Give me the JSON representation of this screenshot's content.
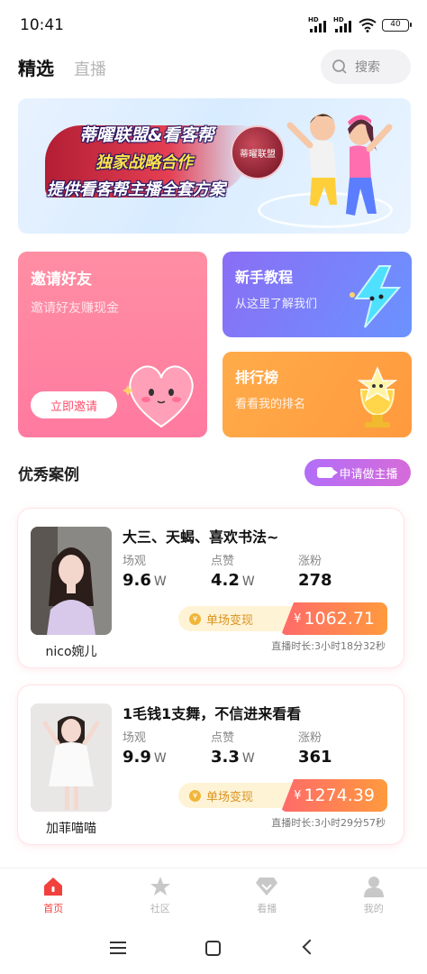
{
  "status_bar": {
    "time": "10:41",
    "signal1_label": "HD",
    "signal2_label": "HD",
    "battery": "40"
  },
  "header": {
    "tabs": [
      {
        "label": "精选",
        "active": true
      },
      {
        "label": "直播",
        "active": false
      }
    ],
    "search": {
      "placeholder": "搜索",
      "icon": "search-icon"
    }
  },
  "banner": {
    "line1": "蒂曜联盟&看客帮",
    "line2": "独家战略合作",
    "line3": "提供看客帮主播全套方案",
    "logo_text": "蒂曜联盟"
  },
  "cards": {
    "invite": {
      "title": "邀请好友",
      "subtitle": "邀请好友赚现金",
      "button": "立即邀请",
      "icon": "heart-icon"
    },
    "tutorial": {
      "title": "新手教程",
      "subtitle": "从这里了解我们",
      "icon": "lightning-icon"
    },
    "rank": {
      "title": "排行榜",
      "subtitle": "看看我的排名",
      "icon": "trophy-icon"
    }
  },
  "section": {
    "title": "优秀案例",
    "apply_button": "申请做主播",
    "apply_icon": "live-camera-icon"
  },
  "labels": {
    "views": "场观",
    "likes": "点赞",
    "fans": "涨粉",
    "revenue": "单场变现",
    "unit_w": "W",
    "yen": "¥",
    "coin": "¥"
  },
  "cases": [
    {
      "name": "nico婉儿",
      "headline": "大三、天蝎、喜欢书法~",
      "views": "9.6",
      "likes": "4.2",
      "fans": "278",
      "revenue": "1062.71",
      "duration": "直播时长:3小时18分32秒"
    },
    {
      "name": "加菲喵喵",
      "headline": "1毛钱1支舞，不信进来看看",
      "views": "9.9",
      "likes": "3.3",
      "fans": "361",
      "revenue": "1274.39",
      "duration": "直播时长:3小时29分57秒"
    }
  ],
  "tabbar": [
    {
      "label": "首页",
      "icon": "home-icon",
      "active": true
    },
    {
      "label": "社区",
      "icon": "star-icon",
      "active": false
    },
    {
      "label": "看播",
      "icon": "diamond-icon",
      "active": false
    },
    {
      "label": "我的",
      "icon": "person-icon",
      "active": false
    }
  ],
  "colors": {
    "accent": "#f0413d",
    "invite_card": "#ff8ea3",
    "tutorial_card": "#7a82f8",
    "rank_card": "#ffa545",
    "revenue": "#ff7a4d"
  }
}
